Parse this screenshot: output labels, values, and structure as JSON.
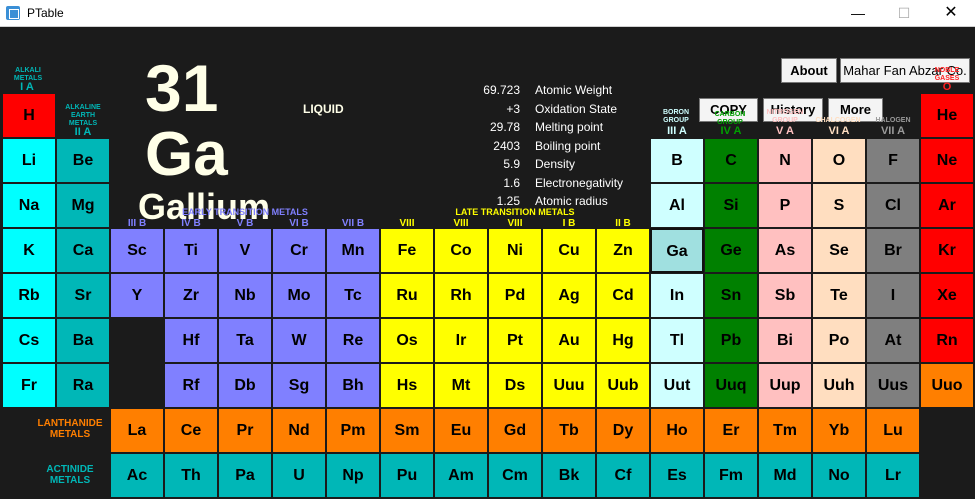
{
  "window": {
    "title": "PTable",
    "min": "—",
    "max": "☐",
    "close": "✕"
  },
  "element": {
    "number": "31",
    "symbol": "Ga",
    "name": "Gallium",
    "state": "LIQUID",
    "properties": [
      {
        "value": "69.723",
        "label": "Atomic Weight"
      },
      {
        "value": "+3",
        "label": "Oxidation State"
      },
      {
        "value": "29.78",
        "label": "Melting point"
      },
      {
        "value": "2403",
        "label": "Boiling point"
      },
      {
        "value": "5.9",
        "label": "Density"
      },
      {
        "value": "1.6",
        "label": "Electronegativity"
      },
      {
        "value": "1.25",
        "label": "Atomic radius"
      }
    ]
  },
  "buttons": {
    "about": "About",
    "company": "Mahar Fan Abzar Co.",
    "copy": "COPY",
    "history": "History",
    "more": "More"
  },
  "colors": {
    "alkali": "#00ffff",
    "alkaline": "#00b7b7",
    "transition_early": "#8080ff",
    "transition_late": "#ffff00",
    "boron": "#cfffff",
    "carbon": "#008000",
    "nitrogen": "#ffc0c0",
    "chalcogen": "#ffdec0",
    "halogen": "#7f7f7f",
    "noble": "#ff0000",
    "lanthanide": "#ff7f00",
    "actinide": "#00b7b7",
    "hydrogen": "#ff0000",
    "selected": "#a0e0e0"
  },
  "groups": {
    "alkali": {
      "name": "ALKALI METALS",
      "roman": "I A"
    },
    "alkaline": {
      "name": "ALKALINE EARTH METALS",
      "roman": "II A"
    },
    "early": "EARLY TRANSITION METALS",
    "late": "LATE TRANSITION METALS",
    "transition_roman": [
      "III B",
      "IV B",
      "V B",
      "VI B",
      "VII B",
      "VIII",
      "VIII",
      "VIII",
      "I B",
      "II B"
    ],
    "boron": {
      "name": "BORON GROUP",
      "roman": "III A"
    },
    "carbon": {
      "name": "CARBON GROUP",
      "roman": "IV A"
    },
    "nitrogen": {
      "name": "NITROGEN GROUP",
      "roman": "V A"
    },
    "chalcogen": {
      "name": "CHALCOGEN",
      "roman": "VI A"
    },
    "halogen": {
      "name": "HALOGEN",
      "roman": "VII A"
    },
    "noble": {
      "name": "NOBLE GASES",
      "roman": "O"
    },
    "lanthanide": "LANTHANIDE METALS",
    "actinide": "ACTINIDE METALS"
  },
  "table": [
    {
      "s": "H",
      "c": "hydrogen",
      "col": 0,
      "row": 0
    },
    {
      "s": "He",
      "c": "noble",
      "col": 17,
      "row": 0
    },
    {
      "s": "Li",
      "c": "alkali",
      "col": 0,
      "row": 1
    },
    {
      "s": "Be",
      "c": "alkaline",
      "col": 1,
      "row": 1
    },
    {
      "s": "B",
      "c": "boron",
      "col": 12,
      "row": 1
    },
    {
      "s": "C",
      "c": "carbon",
      "col": 13,
      "row": 1
    },
    {
      "s": "N",
      "c": "nitrogen",
      "col": 14,
      "row": 1
    },
    {
      "s": "O",
      "c": "chalcogen",
      "col": 15,
      "row": 1
    },
    {
      "s": "F",
      "c": "halogen",
      "col": 16,
      "row": 1
    },
    {
      "s": "Ne",
      "c": "noble",
      "col": 17,
      "row": 1
    },
    {
      "s": "Na",
      "c": "alkali",
      "col": 0,
      "row": 2
    },
    {
      "s": "Mg",
      "c": "alkaline",
      "col": 1,
      "row": 2
    },
    {
      "s": "Al",
      "c": "boron",
      "col": 12,
      "row": 2
    },
    {
      "s": "Si",
      "c": "carbon",
      "col": 13,
      "row": 2
    },
    {
      "s": "P",
      "c": "nitrogen",
      "col": 14,
      "row": 2
    },
    {
      "s": "S",
      "c": "chalcogen",
      "col": 15,
      "row": 2
    },
    {
      "s": "Cl",
      "c": "halogen",
      "col": 16,
      "row": 2
    },
    {
      "s": "Ar",
      "c": "noble",
      "col": 17,
      "row": 2
    },
    {
      "s": "K",
      "c": "alkali",
      "col": 0,
      "row": 3
    },
    {
      "s": "Ca",
      "c": "alkaline",
      "col": 1,
      "row": 3
    },
    {
      "s": "Sc",
      "c": "transition_early",
      "col": 2,
      "row": 3
    },
    {
      "s": "Ti",
      "c": "transition_early",
      "col": 3,
      "row": 3
    },
    {
      "s": "V",
      "c": "transition_early",
      "col": 4,
      "row": 3
    },
    {
      "s": "Cr",
      "c": "transition_early",
      "col": 5,
      "row": 3
    },
    {
      "s": "Mn",
      "c": "transition_early",
      "col": 6,
      "row": 3
    },
    {
      "s": "Fe",
      "c": "transition_late",
      "col": 7,
      "row": 3
    },
    {
      "s": "Co",
      "c": "transition_late",
      "col": 8,
      "row": 3
    },
    {
      "s": "Ni",
      "c": "transition_late",
      "col": 9,
      "row": 3
    },
    {
      "s": "Cu",
      "c": "transition_late",
      "col": 10,
      "row": 3
    },
    {
      "s": "Zn",
      "c": "transition_late",
      "col": 11,
      "row": 3
    },
    {
      "s": "Ga",
      "c": "selected",
      "col": 12,
      "row": 3,
      "selected": true
    },
    {
      "s": "Ge",
      "c": "carbon",
      "col": 13,
      "row": 3
    },
    {
      "s": "As",
      "c": "nitrogen",
      "col": 14,
      "row": 3
    },
    {
      "s": "Se",
      "c": "chalcogen",
      "col": 15,
      "row": 3
    },
    {
      "s": "Br",
      "c": "halogen",
      "col": 16,
      "row": 3
    },
    {
      "s": "Kr",
      "c": "noble",
      "col": 17,
      "row": 3
    },
    {
      "s": "Rb",
      "c": "alkali",
      "col": 0,
      "row": 4
    },
    {
      "s": "Sr",
      "c": "alkaline",
      "col": 1,
      "row": 4
    },
    {
      "s": "Y",
      "c": "transition_early",
      "col": 2,
      "row": 4
    },
    {
      "s": "Zr",
      "c": "transition_early",
      "col": 3,
      "row": 4
    },
    {
      "s": "Nb",
      "c": "transition_early",
      "col": 4,
      "row": 4
    },
    {
      "s": "Mo",
      "c": "transition_early",
      "col": 5,
      "row": 4
    },
    {
      "s": "Tc",
      "c": "transition_early",
      "col": 6,
      "row": 4
    },
    {
      "s": "Ru",
      "c": "transition_late",
      "col": 7,
      "row": 4
    },
    {
      "s": "Rh",
      "c": "transition_late",
      "col": 8,
      "row": 4
    },
    {
      "s": "Pd",
      "c": "transition_late",
      "col": 9,
      "row": 4
    },
    {
      "s": "Ag",
      "c": "transition_late",
      "col": 10,
      "row": 4
    },
    {
      "s": "Cd",
      "c": "transition_late",
      "col": 11,
      "row": 4
    },
    {
      "s": "In",
      "c": "boron",
      "col": 12,
      "row": 4
    },
    {
      "s": "Sn",
      "c": "carbon",
      "col": 13,
      "row": 4
    },
    {
      "s": "Sb",
      "c": "nitrogen",
      "col": 14,
      "row": 4
    },
    {
      "s": "Te",
      "c": "chalcogen",
      "col": 15,
      "row": 4
    },
    {
      "s": "I",
      "c": "halogen",
      "col": 16,
      "row": 4
    },
    {
      "s": "Xe",
      "c": "noble",
      "col": 17,
      "row": 4
    },
    {
      "s": "Cs",
      "c": "alkali",
      "col": 0,
      "row": 5
    },
    {
      "s": "Ba",
      "c": "alkaline",
      "col": 1,
      "row": 5
    },
    {
      "s": "Hf",
      "c": "transition_early",
      "col": 3,
      "row": 5
    },
    {
      "s": "Ta",
      "c": "transition_early",
      "col": 4,
      "row": 5
    },
    {
      "s": "W",
      "c": "transition_early",
      "col": 5,
      "row": 5
    },
    {
      "s": "Re",
      "c": "transition_early",
      "col": 6,
      "row": 5
    },
    {
      "s": "Os",
      "c": "transition_late",
      "col": 7,
      "row": 5
    },
    {
      "s": "Ir",
      "c": "transition_late",
      "col": 8,
      "row": 5
    },
    {
      "s": "Pt",
      "c": "transition_late",
      "col": 9,
      "row": 5
    },
    {
      "s": "Au",
      "c": "transition_late",
      "col": 10,
      "row": 5
    },
    {
      "s": "Hg",
      "c": "transition_late",
      "col": 11,
      "row": 5
    },
    {
      "s": "Tl",
      "c": "boron",
      "col": 12,
      "row": 5
    },
    {
      "s": "Pb",
      "c": "carbon",
      "col": 13,
      "row": 5
    },
    {
      "s": "Bi",
      "c": "nitrogen",
      "col": 14,
      "row": 5
    },
    {
      "s": "Po",
      "c": "chalcogen",
      "col": 15,
      "row": 5
    },
    {
      "s": "At",
      "c": "halogen",
      "col": 16,
      "row": 5
    },
    {
      "s": "Rn",
      "c": "noble",
      "col": 17,
      "row": 5
    },
    {
      "s": "Fr",
      "c": "alkali",
      "col": 0,
      "row": 6
    },
    {
      "s": "Ra",
      "c": "alkaline",
      "col": 1,
      "row": 6
    },
    {
      "s": "Rf",
      "c": "transition_early",
      "col": 3,
      "row": 6
    },
    {
      "s": "Db",
      "c": "transition_early",
      "col": 4,
      "row": 6
    },
    {
      "s": "Sg",
      "c": "transition_early",
      "col": 5,
      "row": 6
    },
    {
      "s": "Bh",
      "c": "transition_early",
      "col": 6,
      "row": 6
    },
    {
      "s": "Hs",
      "c": "transition_late",
      "col": 7,
      "row": 6
    },
    {
      "s": "Mt",
      "c": "transition_late",
      "col": 8,
      "row": 6
    },
    {
      "s": "Ds",
      "c": "transition_late",
      "col": 9,
      "row": 6
    },
    {
      "s": "Uuu",
      "c": "transition_late",
      "col": 10,
      "row": 6
    },
    {
      "s": "Uub",
      "c": "transition_late",
      "col": 11,
      "row": 6
    },
    {
      "s": "Uut",
      "c": "boron",
      "col": 12,
      "row": 6
    },
    {
      "s": "Uuq",
      "c": "carbon",
      "col": 13,
      "row": 6
    },
    {
      "s": "Uup",
      "c": "nitrogen",
      "col": 14,
      "row": 6
    },
    {
      "s": "Uuh",
      "c": "chalcogen",
      "col": 15,
      "row": 6
    },
    {
      "s": "Uus",
      "c": "halogen",
      "col": 16,
      "row": 6
    },
    {
      "s": "Uuo",
      "c": "lanthanide",
      "col": 17,
      "row": 6
    },
    {
      "s": "La",
      "c": "lanthanide",
      "col": 2,
      "row": 7
    },
    {
      "s": "Ce",
      "c": "lanthanide",
      "col": 3,
      "row": 7
    },
    {
      "s": "Pr",
      "c": "lanthanide",
      "col": 4,
      "row": 7
    },
    {
      "s": "Nd",
      "c": "lanthanide",
      "col": 5,
      "row": 7
    },
    {
      "s": "Pm",
      "c": "lanthanide",
      "col": 6,
      "row": 7
    },
    {
      "s": "Sm",
      "c": "lanthanide",
      "col": 7,
      "row": 7
    },
    {
      "s": "Eu",
      "c": "lanthanide",
      "col": 8,
      "row": 7
    },
    {
      "s": "Gd",
      "c": "lanthanide",
      "col": 9,
      "row": 7
    },
    {
      "s": "Tb",
      "c": "lanthanide",
      "col": 10,
      "row": 7
    },
    {
      "s": "Dy",
      "c": "lanthanide",
      "col": 11,
      "row": 7
    },
    {
      "s": "Ho",
      "c": "lanthanide",
      "col": 12,
      "row": 7
    },
    {
      "s": "Er",
      "c": "lanthanide",
      "col": 13,
      "row": 7
    },
    {
      "s": "Tm",
      "c": "lanthanide",
      "col": 14,
      "row": 7
    },
    {
      "s": "Yb",
      "c": "lanthanide",
      "col": 15,
      "row": 7
    },
    {
      "s": "Lu",
      "c": "lanthanide",
      "col": 16,
      "row": 7
    },
    {
      "s": "Ac",
      "c": "actinide",
      "col": 2,
      "row": 8
    },
    {
      "s": "Th",
      "c": "actinide",
      "col": 3,
      "row": 8
    },
    {
      "s": "Pa",
      "c": "actinide",
      "col": 4,
      "row": 8
    },
    {
      "s": "U",
      "c": "actinide",
      "col": 5,
      "row": 8
    },
    {
      "s": "Np",
      "c": "actinide",
      "col": 6,
      "row": 8
    },
    {
      "s": "Pu",
      "c": "actinide",
      "col": 7,
      "row": 8
    },
    {
      "s": "Am",
      "c": "actinide",
      "col": 8,
      "row": 8
    },
    {
      "s": "Cm",
      "c": "actinide",
      "col": 9,
      "row": 8
    },
    {
      "s": "Bk",
      "c": "actinide",
      "col": 10,
      "row": 8
    },
    {
      "s": "Cf",
      "c": "actinide",
      "col": 11,
      "row": 8
    },
    {
      "s": "Es",
      "c": "actinide",
      "col": 12,
      "row": 8
    },
    {
      "s": "Fm",
      "c": "actinide",
      "col": 13,
      "row": 8
    },
    {
      "s": "Md",
      "c": "actinide",
      "col": 14,
      "row": 8
    },
    {
      "s": "No",
      "c": "actinide",
      "col": 15,
      "row": 8
    },
    {
      "s": "Lr",
      "c": "actinide",
      "col": 16,
      "row": 8
    }
  ]
}
